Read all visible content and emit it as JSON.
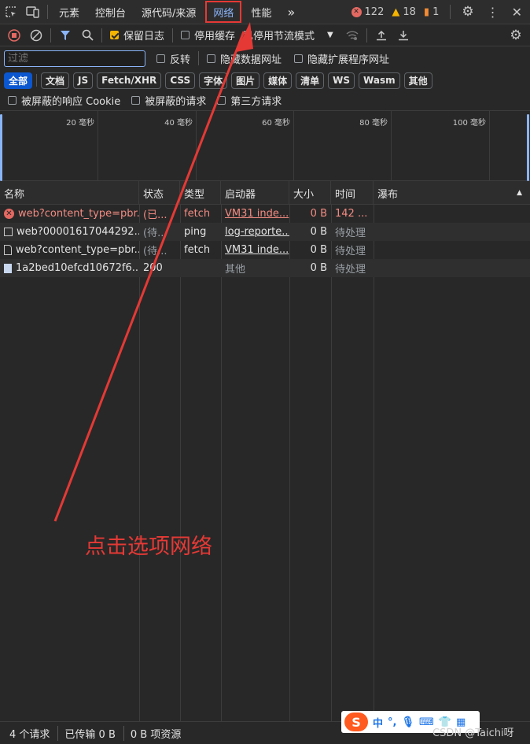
{
  "tabbar": {
    "tabs": [
      "元素",
      "控制台",
      "源代码/来源",
      "网络",
      "性能"
    ],
    "active_tab": "网络",
    "more": "»",
    "errors": "122",
    "warnings": "18",
    "issues": "1"
  },
  "toolbar": {
    "preserve_log": "保留日志",
    "disable_cache": "停用缓存",
    "throttle": "已停用节流模式"
  },
  "filter": {
    "placeholder": "过滤",
    "invert": "反转",
    "hide_data_urls": "隐藏数据网址",
    "hide_extension_urls": "隐藏扩展程序网址"
  },
  "types": [
    "全部",
    "文档",
    "JS",
    "Fetch/XHR",
    "CSS",
    "字体",
    "图片",
    "媒体",
    "清单",
    "WS",
    "Wasm",
    "其他"
  ],
  "blocked": {
    "blocked_cookies": "被屏蔽的响应 Cookie",
    "blocked_requests": "被屏蔽的请求",
    "third_party": "第三方请求"
  },
  "overview": {
    "ticks": [
      "20 毫秒",
      "40 毫秒",
      "60 毫秒",
      "80 毫秒",
      "100 毫秒"
    ]
  },
  "grid": {
    "headers": [
      "名称",
      "状态",
      "类型",
      "启动器",
      "大小",
      "时间",
      "瀑布"
    ],
    "rows": [
      {
        "icon": "error-icon",
        "name": "web?content_type=pbr...",
        "status": "(已...",
        "type": "fetch",
        "initiator": "VM31 inde...",
        "size": "0 B",
        "time": "142 ..."
      },
      {
        "icon": "checkbox-icon",
        "name": "web?00001617044292...",
        "status": "(待...",
        "type": "ping",
        "initiator": "log-reporte...",
        "size": "0 B",
        "time": "待处理"
      },
      {
        "icon": "document-icon",
        "name": "web?content_type=pbr...",
        "status": "(待...",
        "type": "fetch",
        "initiator": "VM31 inde...",
        "size": "0 B",
        "time": "待处理"
      },
      {
        "icon": "image-icon",
        "name": "1a2bed10efcd10672f6...",
        "status": "200",
        "type": "",
        "initiator": "其他",
        "size": "0 B",
        "time": "待处理"
      }
    ]
  },
  "statusbar": {
    "requests": "4 个请求",
    "transferred": "已传输 0 B",
    "resources": "0 B 项资源"
  },
  "ime": {
    "lang": "中",
    "punct": "°,"
  },
  "watermark": "CSDN @Taichi呀",
  "annotation": "点击选项网络",
  "colors": {
    "accent": "#8ab4f8",
    "annotation": "#e53935",
    "error": "#e46962",
    "warning": "#f4b400"
  }
}
